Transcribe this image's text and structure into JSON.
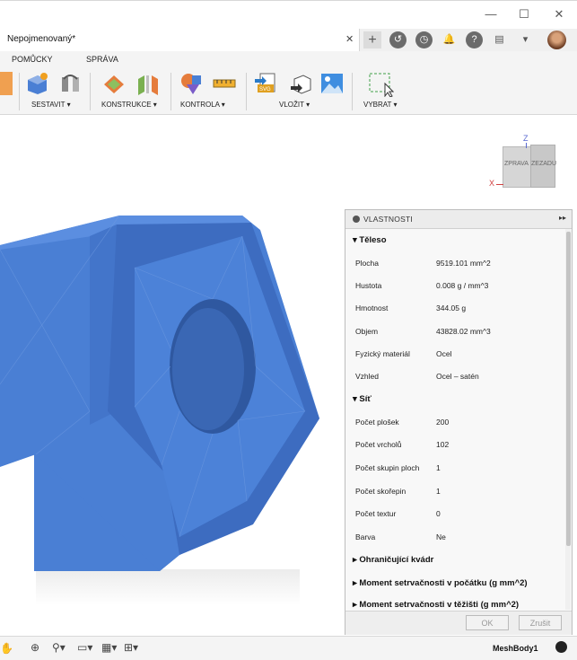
{
  "window": {
    "minimize": "—",
    "maximize": "☐",
    "close": "✕"
  },
  "document_tab": {
    "title": "Nepojmenovaný*",
    "close": "✕",
    "add": "+"
  },
  "ribbon": {
    "tabs": [
      "POMŮCKY",
      "SPRÁVA"
    ],
    "groups": [
      "SESTAVIT ▾",
      "KONSTRUKCE ▾",
      "KONTROLA ▾",
      "VLOŽIT ▾",
      "VYBRAT ▾"
    ]
  },
  "viewcube": {
    "right": "ZPRAVA",
    "back": "ZEZADU",
    "axis_z": "Z",
    "axis_x": "X"
  },
  "properties": {
    "title": "VLASTNOSTI",
    "body_section": "Těleso",
    "body_rows": [
      {
        "label": "Plocha",
        "value": "9519.101 mm^2"
      },
      {
        "label": "Hustota",
        "value": "0.008 g / mm^3"
      },
      {
        "label": "Hmotnost",
        "value": "344.05 g"
      },
      {
        "label": "Objem",
        "value": "43828.02 mm^3"
      },
      {
        "label": "Fyzický materiál",
        "value": "Ocel"
      },
      {
        "label": "Vzhled",
        "value": "Ocel – satén"
      }
    ],
    "mesh_section": "Síť",
    "mesh_rows": [
      {
        "label": "Počet plošek",
        "value": "200"
      },
      {
        "label": "Počet vrcholů",
        "value": "102"
      },
      {
        "label": "Počet skupin ploch",
        "value": "1"
      },
      {
        "label": "Počet skořepin",
        "value": "1"
      },
      {
        "label": "Počet textur",
        "value": "0"
      },
      {
        "label": "Barva",
        "value": "Ne"
      }
    ],
    "collapsed_sections": [
      "Ohraničující kvádr",
      "Moment setrvačnosti v počátku  (g mm^2)",
      "Moment setrvačnosti v těžišti  (g mm^2)"
    ],
    "ok_label": "OK",
    "cancel_label": "Zrušit"
  },
  "status": {
    "body_name": "MeshBody1"
  },
  "colors": {
    "mesh_blue": "#4a7fd4",
    "panel_bg": "#f8f8f8"
  }
}
